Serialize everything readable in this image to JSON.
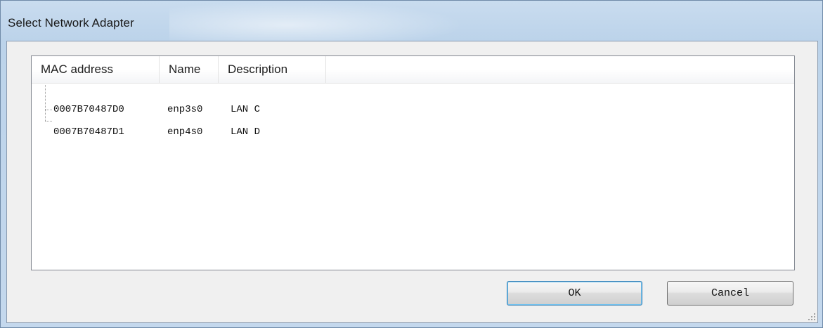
{
  "window": {
    "title": "Select Network Adapter"
  },
  "list": {
    "columns": [
      "MAC address",
      "Name",
      "Description"
    ],
    "rows": [
      {
        "mac": "0007B70487D0",
        "name": "enp3s0",
        "description": "LAN C"
      },
      {
        "mac": "0007B70487D1",
        "name": "enp4s0",
        "description": "LAN D"
      }
    ]
  },
  "buttons": {
    "ok_label": "OK",
    "cancel_label": "Cancel"
  },
  "colors": {
    "frame": "#c4d8ed",
    "client": "#f0f0f0",
    "default_button_border": "#3c7fb1"
  },
  "icons": {
    "resize_grip": "size-grip-icon"
  }
}
